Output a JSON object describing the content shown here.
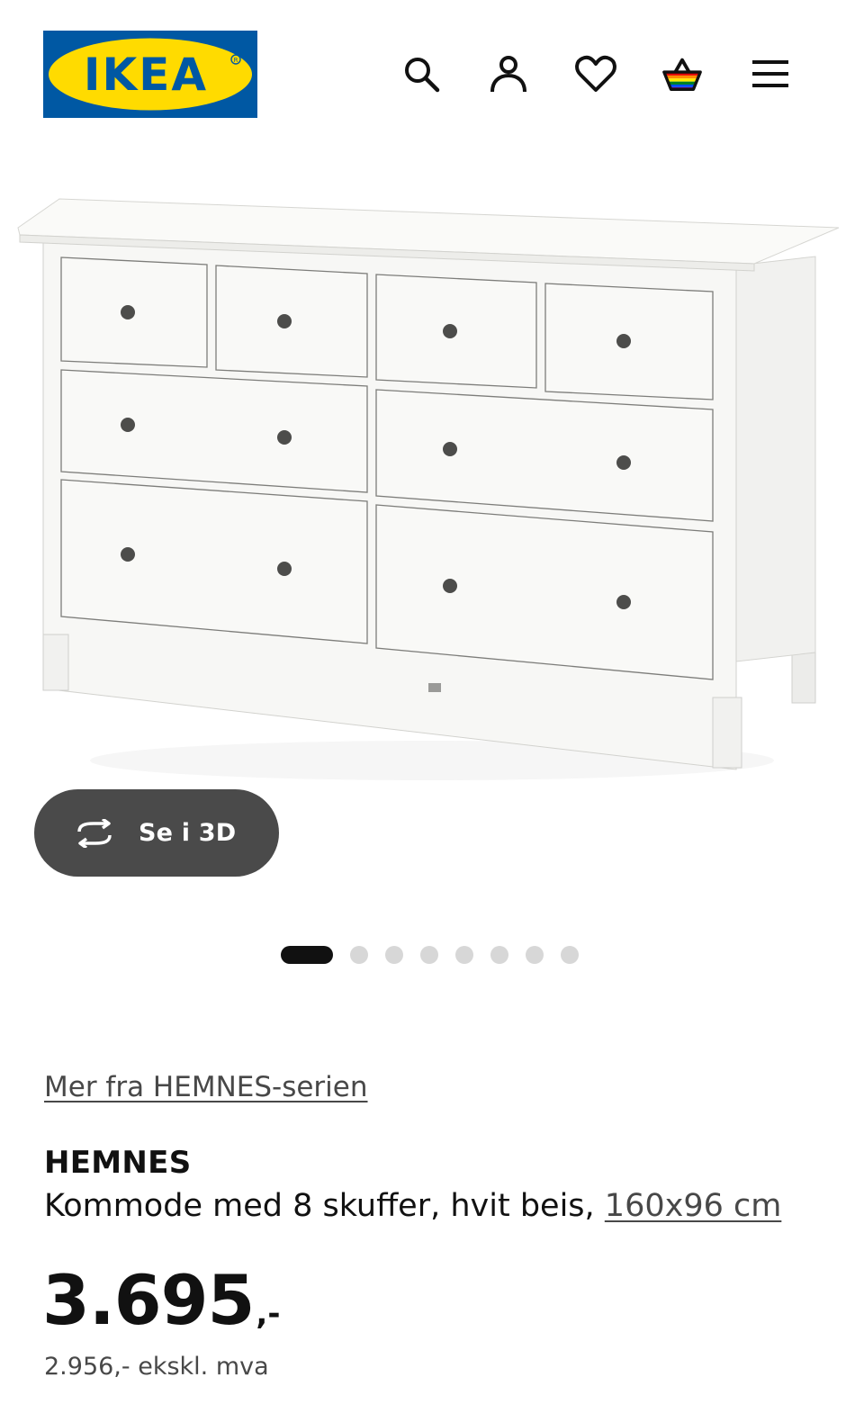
{
  "header": {
    "logo_text": "IKEA",
    "icons": [
      "search-icon",
      "profile-icon",
      "heart-icon",
      "cart-icon",
      "menu-icon"
    ]
  },
  "colors": {
    "ikea_blue": "#0058a3",
    "ikea_yellow": "#ffdb00",
    "button_dark": "#4a4a4a",
    "text": "#111111",
    "muted_text": "#484848"
  },
  "gallery": {
    "button_3d_label": "Se i 3D",
    "total_images": 8,
    "active_index": 0
  },
  "product": {
    "series_link": "Mer fra HEMNES-serien",
    "name": "HEMNES",
    "description": "Kommode med 8 skuffer, hvit beis, ",
    "size_link": "160x96 cm",
    "price_int": "3.695",
    "price_suffix": ",-",
    "price_ex_vat": "2.956,- ekskl. mva"
  }
}
